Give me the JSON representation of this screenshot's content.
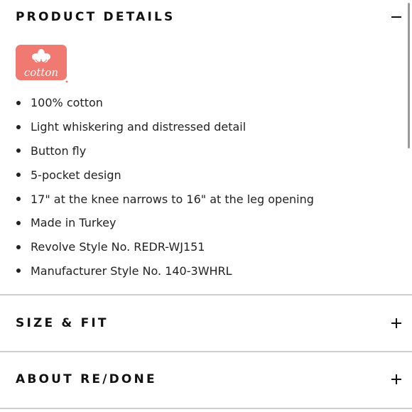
{
  "sections": {
    "product_details": {
      "title": "PRODUCT DETAILS",
      "toggle_icon": "minus-icon",
      "expanded": true,
      "logo": {
        "name": "cotton-seal-logo",
        "text": "cotton",
        "color": "#f07a72"
      },
      "items": [
        "100% cotton",
        "Light whiskering and distressed detail",
        "Button fly",
        "5-pocket design",
        "17\" at the knee narrows to 16\" at the leg opening",
        "Made in Turkey",
        "Revolve Style No. REDR-WJ151",
        "Manufacturer Style No. 140-3WHRL"
      ]
    },
    "size_fit": {
      "title": "SIZE & FIT",
      "toggle_icon": "plus-icon",
      "expanded": false
    },
    "about": {
      "title": "ABOUT RE/DONE",
      "toggle_icon": "plus-icon",
      "expanded": false
    }
  },
  "colors": {
    "text": "#1a1a1a",
    "divider": "#cfcfcf",
    "logo_red": "#f07a72"
  }
}
